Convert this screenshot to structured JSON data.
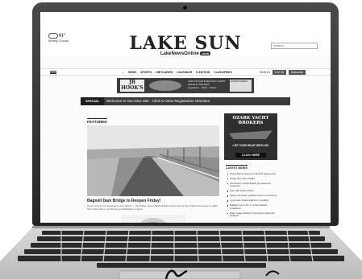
{
  "site": {
    "title": "LAKE SUN",
    "subtitle": "LakeNewsOnline",
    "subtitle_badge": ".com",
    "weather_temp": "61°",
    "weather_desc": "Mostly Cloudy",
    "search_placeholder": "Search..."
  },
  "nav": {
    "items": [
      "NEWS",
      "SPORTS",
      "OBITUARIES",
      "CALENDAR",
      "E-EDITION",
      "CLASSIFIEDS"
    ],
    "login": "SIGN IN",
    "login_btn": "LOG IN",
    "subscribe_btn": "Subscribe"
  },
  "ad_banner": {
    "brand": "JB HOOK'S",
    "text": "JOIN US FOR EVERYDAY HAPPY HOUR IN THE BAR",
    "subtext": "Appetizers · Pizza · Drinks",
    "entertainment": "ENTERTAINMENT"
  },
  "special": {
    "tag": "SPECIAL",
    "text": "Welcome to Our New Site - Click to View Registration Direction"
  },
  "featured": {
    "label": "FEATURED",
    "headline": "Bagnell Dam Bridge to Reopen Friday!",
    "blurb": "Good news for local residents and visitors — the bridge across Bagnell Dam at the Lake of the Ozarks will reopen to traffic this Friday after a months-long rehabilitation project."
  },
  "side_ad": {
    "title": "OZARK YACHT BROKERS",
    "line1": "LIST YOUR BOAT WITH US!",
    "cta": "CLICK HERE"
  },
  "latest": {
    "label": "LATEST NEWS",
    "items": [
      "Three fishers rescued on April 26 opening day",
      "Osage wins third straight",
      "Camdenton, Osage Beach gift 'awesome' restaurant",
      "Lake rally draws visitors",
      "Fishers dominate 'sunflower fest' in conference",
      "Local Lake Charter Hall fun in spotlight",
      "Bulldogs rise to No. 1 in final Catholic Invitational",
      "Major League Fishing Tournament draws this weekend"
    ]
  }
}
